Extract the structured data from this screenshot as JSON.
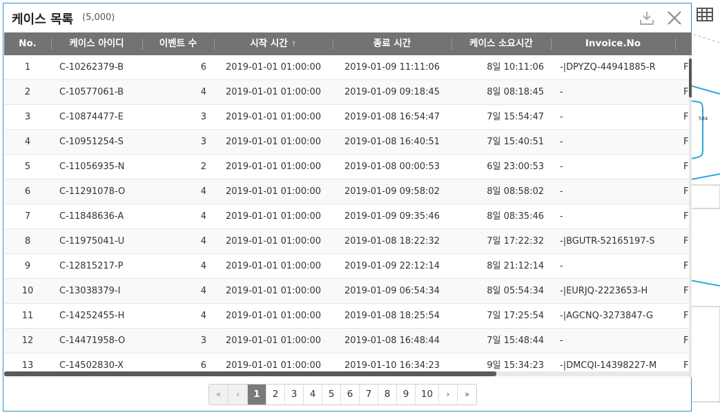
{
  "modal": {
    "title": "케이스 목록",
    "count": "(5,000)",
    "icons": {
      "download": "download-icon",
      "close": "close-icon"
    }
  },
  "background": {
    "grid_icon": "table-grid-icon",
    "node_label": "584",
    "accent": "#29a8d8"
  },
  "table": {
    "headers": [
      "No.",
      "케이스 아이디",
      "이벤트 수",
      "시작 시간",
      "종료 시간",
      "케이스 소요시간",
      "Invoice.No"
    ],
    "sort_indicator": "↑",
    "rows": [
      {
        "no": "1",
        "id": "C-10262379-B",
        "events": "6",
        "start": "2019-01-01 01:00:00",
        "end": "2019-01-09 11:11:06",
        "duration": "8일 10:11:06",
        "invoice": "-|DPYZQ-44941885-R",
        "extra": "F"
      },
      {
        "no": "2",
        "id": "C-10577061-B",
        "events": "4",
        "start": "2019-01-01 01:00:00",
        "end": "2019-01-09 09:18:45",
        "duration": "8일 08:18:45",
        "invoice": "-",
        "extra": "F"
      },
      {
        "no": "3",
        "id": "C-10874477-E",
        "events": "3",
        "start": "2019-01-01 01:00:00",
        "end": "2019-01-08 16:54:47",
        "duration": "7일 15:54:47",
        "invoice": "-",
        "extra": "F"
      },
      {
        "no": "4",
        "id": "C-10951254-S",
        "events": "3",
        "start": "2019-01-01 01:00:00",
        "end": "2019-01-08 16:40:51",
        "duration": "7일 15:40:51",
        "invoice": "-",
        "extra": "F"
      },
      {
        "no": "5",
        "id": "C-11056935-N",
        "events": "2",
        "start": "2019-01-01 01:00:00",
        "end": "2019-01-08 00:00:53",
        "duration": "6일 23:00:53",
        "invoice": "-",
        "extra": "F"
      },
      {
        "no": "6",
        "id": "C-11291078-O",
        "events": "4",
        "start": "2019-01-01 01:00:00",
        "end": "2019-01-09 09:58:02",
        "duration": "8일 08:58:02",
        "invoice": "-",
        "extra": "F"
      },
      {
        "no": "7",
        "id": "C-11848636-A",
        "events": "4",
        "start": "2019-01-01 01:00:00",
        "end": "2019-01-09 09:35:46",
        "duration": "8일 08:35:46",
        "invoice": "-",
        "extra": "F"
      },
      {
        "no": "8",
        "id": "C-11975041-U",
        "events": "4",
        "start": "2019-01-01 01:00:00",
        "end": "2019-01-08 18:22:32",
        "duration": "7일 17:22:32",
        "invoice": "-|BGUTR-52165197-S",
        "extra": "F"
      },
      {
        "no": "9",
        "id": "C-12815217-P",
        "events": "4",
        "start": "2019-01-01 01:00:00",
        "end": "2019-01-09 22:12:14",
        "duration": "8일 21:12:14",
        "invoice": "-",
        "extra": "F"
      },
      {
        "no": "10",
        "id": "C-13038379-I",
        "events": "4",
        "start": "2019-01-01 01:00:00",
        "end": "2019-01-09 06:54:34",
        "duration": "8일 05:54:34",
        "invoice": "-|EURJQ-2223653-H",
        "extra": "F"
      },
      {
        "no": "11",
        "id": "C-14252455-H",
        "events": "4",
        "start": "2019-01-01 01:00:00",
        "end": "2019-01-08 18:25:54",
        "duration": "7일 17:25:54",
        "invoice": "-|AGCNQ-3273847-G",
        "extra": "F"
      },
      {
        "no": "12",
        "id": "C-14471958-O",
        "events": "3",
        "start": "2019-01-01 01:00:00",
        "end": "2019-01-08 16:48:44",
        "duration": "7일 15:48:44",
        "invoice": "-",
        "extra": "F"
      },
      {
        "no": "13",
        "id": "C-14502830-X",
        "events": "6",
        "start": "2019-01-01 01:00:00",
        "end": "2019-01-10 16:34:23",
        "duration": "9일 15:34:23",
        "invoice": "-|DMCQI-14398227-M",
        "extra": "F"
      }
    ]
  },
  "pagination": {
    "first": "«",
    "prev": "‹",
    "pages": [
      "1",
      "2",
      "3",
      "4",
      "5",
      "6",
      "7",
      "8",
      "9",
      "10"
    ],
    "current": "1",
    "next": "›",
    "last": "»"
  }
}
